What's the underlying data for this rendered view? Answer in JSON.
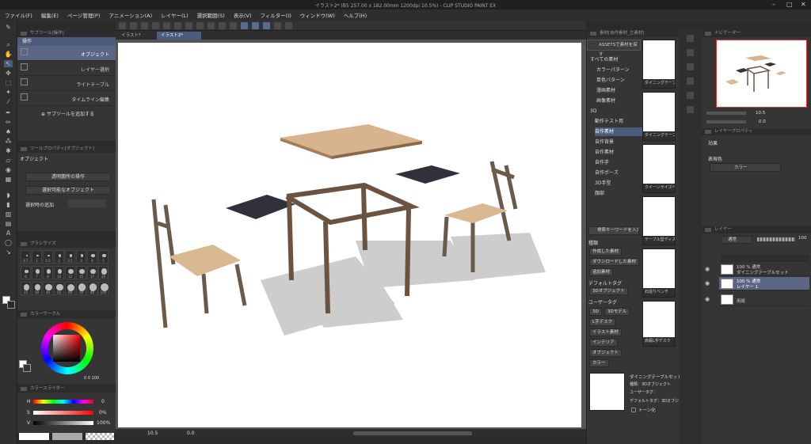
{
  "title": "イラスト2* (B5 257.00 x 182.00mm 1200dpi 10.5%)  - CLIP STUDIO PAINT EX",
  "menu": [
    "ファイル(F)",
    "編集(E)",
    "ページ管理(P)",
    "アニメーション(A)",
    "レイヤー(L)",
    "選択範囲(S)",
    "表示(V)",
    "フィルター(I)",
    "ウィンドウ(W)",
    "ヘルプ(H)"
  ],
  "subtool": {
    "header": "サブツール[操作]",
    "group": "操作",
    "items": [
      "オブジェクト",
      "レイヤー選択",
      "ライトテーブル",
      "タイムライン編集"
    ],
    "add": "サブツールを追加する"
  },
  "toolprop": {
    "header": "ツールプロパティ[オブジェクト]",
    "name": "オブジェクト",
    "dd1": "透明箇所の操作",
    "dd2": "選択可能なオブジェクト",
    "row3": "選択時の追加"
  },
  "brush": {
    "header": "ブラシサイズ",
    "sizes": [
      "0.7",
      "1",
      "1.5",
      "2",
      "2.5",
      "3",
      "4",
      "5",
      "6",
      "7",
      "8",
      "10",
      "12",
      "15",
      "17",
      "20",
      "25",
      "30",
      "40",
      "50",
      "60",
      "70",
      "80",
      "100"
    ]
  },
  "colorcircle": {
    "header": "カラーサークル",
    "readout": "0 0 100"
  },
  "colorslider": {
    "header": "カラースライダー",
    "h": "H",
    "s": "S",
    "v": "V",
    "hv": "0",
    "sv": "0%",
    "vv": "100%"
  },
  "tabs": [
    "イラスト*",
    "イラスト2*"
  ],
  "bottom": {
    "zoom": "10.5",
    "angle": "0.0"
  },
  "materials": {
    "header": "素材[自作素材_立素材]",
    "assets": "ASSETSで素材を探す",
    "tree": [
      "すべての素材",
      "カラーパターン",
      "単色パターン",
      "漫画素材",
      "画像素材",
      "3D",
      "動作テスト用",
      "自作素材",
      "自作背景",
      "自作素材",
      "自作手",
      "自作ポーズ",
      "3D手型",
      "顔部"
    ],
    "search": "検索キーワードを入力",
    "kind": "種類",
    "tags1": [
      "作成した素材",
      "ダウンロードした素材",
      "追加素材"
    ],
    "default": "デフォルトタグ",
    "tag3d": "3Dオブジェクト",
    "user": "ユーザータグ",
    "tags2": [
      "3D",
      "3Dモデル",
      "L字デスク",
      "イラスト素材",
      "インテリア",
      "オブジェクト",
      "カラー"
    ],
    "thumbs": [
      "ダイニングテーブル",
      "ダイニングテーブ",
      "クイーンサイズベッド",
      "テーブル型ディスプ",
      "石造りベンチ",
      "高級L字デスク"
    ],
    "info": {
      "name": "ダイニングテーブルセット",
      "type": "種類：3Dオブジェクト",
      "usertag": "ユーザータグ：",
      "deftag": "デフォルトタグ：3Dオブジェクト",
      "tone": "トーン化"
    }
  },
  "navigator": {
    "header": "ナビゲーター",
    "zoom": "10.5",
    "angle": "0.0"
  },
  "layerprop": {
    "header": "レイヤープロパティ",
    "effect": "効果",
    "color": "表現色",
    "colorval": "カラー"
  },
  "layers": {
    "header": "レイヤー",
    "blend": "通常",
    "opacity": "100",
    "items": [
      {
        "n1": "100 % 通常",
        "n2": "ダイニングテーブルセット"
      },
      {
        "n1": "100 % 通常",
        "n2": "レイヤー 1"
      },
      {
        "n1": "",
        "n2": "用紙"
      }
    ]
  }
}
